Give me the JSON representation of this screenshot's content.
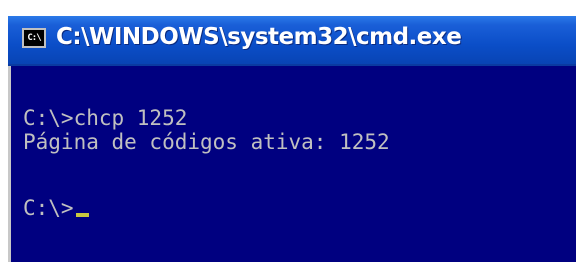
{
  "window": {
    "title": "C:\\WINDOWS\\system32\\cmd.exe",
    "icon": "cmd-icon",
    "icon_text": "C:\\"
  },
  "console": {
    "lines": [
      "C:\\>chcp 1252",
      "Página de códigos ativa: 1252",
      "C:\\>"
    ],
    "background_color": "#000080",
    "text_color": "#c0c0c0",
    "cursor_color": "#c8c840"
  }
}
